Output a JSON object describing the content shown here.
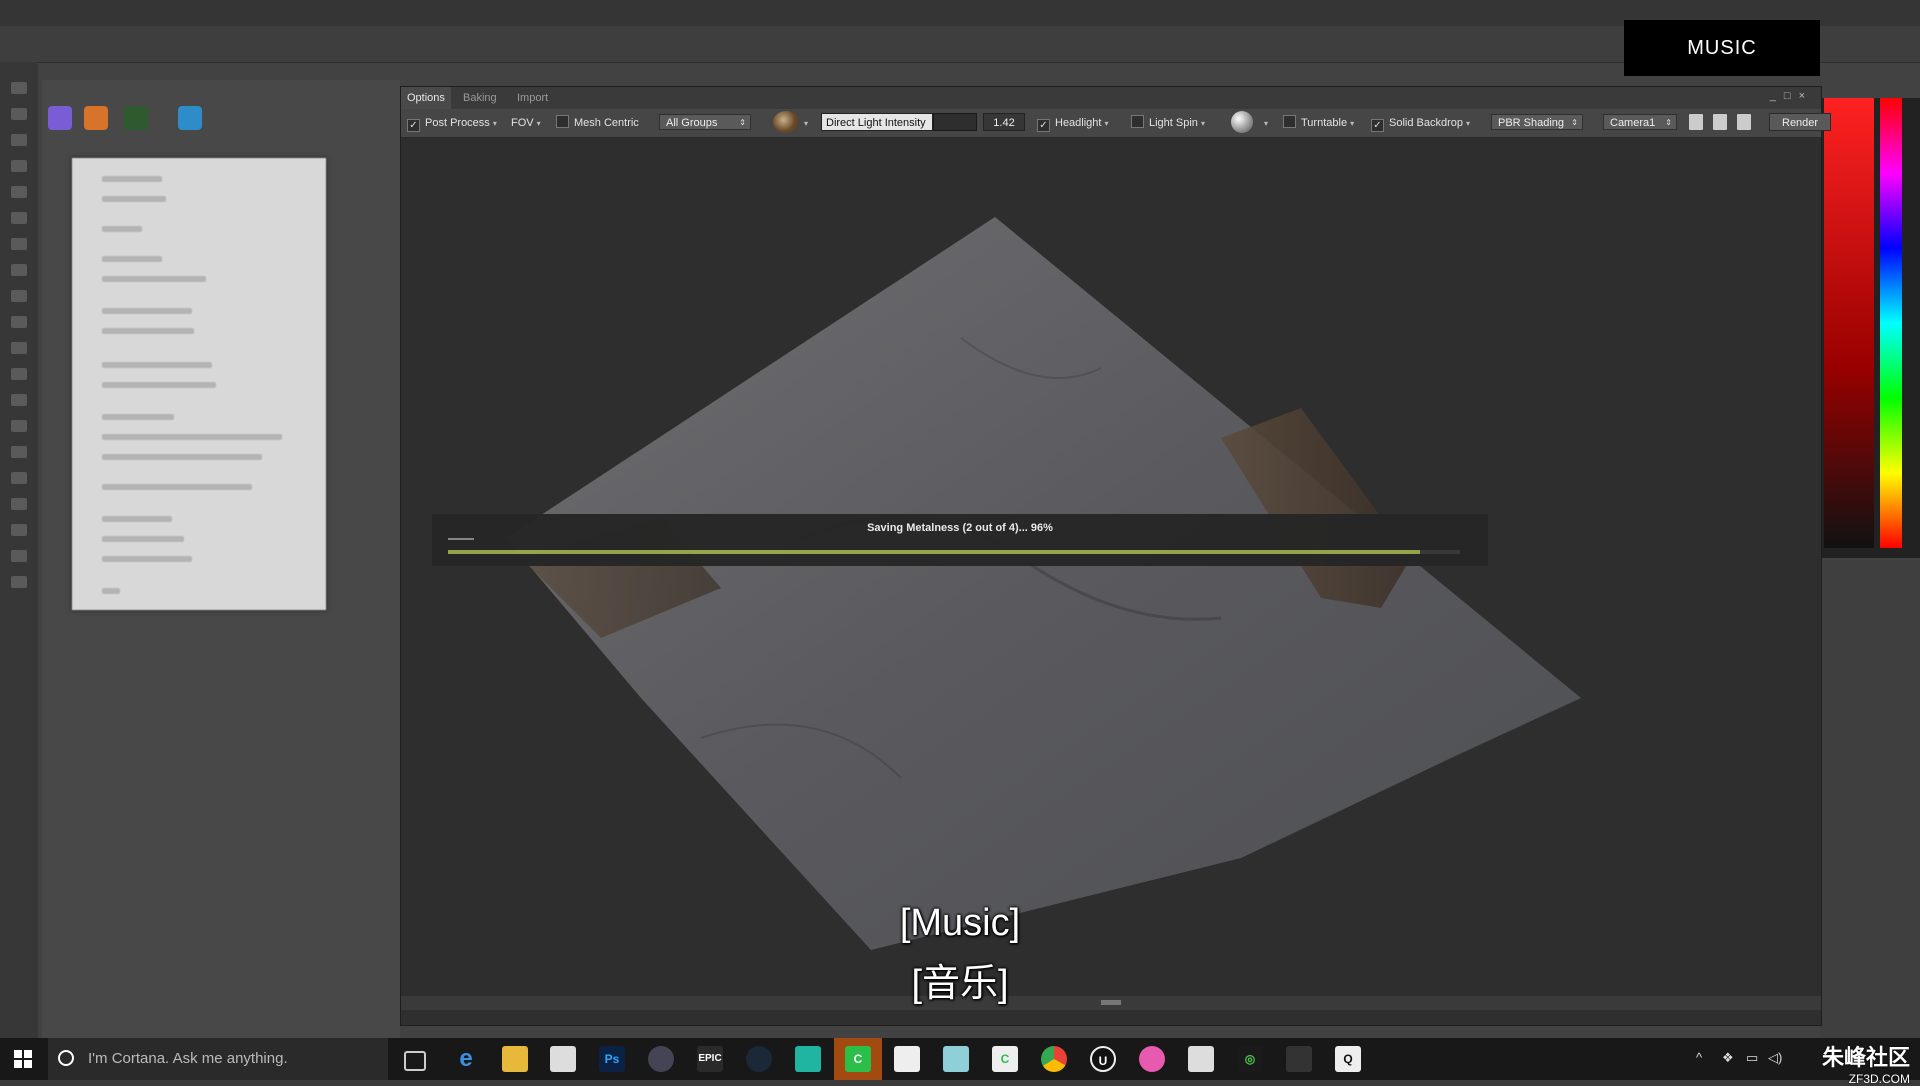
{
  "overlay": {
    "music_tag": "MUSIC"
  },
  "renderer": {
    "tabs": [
      {
        "label": "Options",
        "active": true
      },
      {
        "label": "Baking",
        "active": false
      },
      {
        "label": "Import",
        "active": false
      }
    ],
    "options_bar": {
      "post_process": {
        "label": "Post Process",
        "checked": true
      },
      "fov": {
        "label": "FOV"
      },
      "mesh_centric": {
        "label": "Mesh Centric",
        "checked": false
      },
      "groups_select": "All Groups",
      "light_intensity_label": "Direct Light Intensity",
      "light_intensity_value": "1.42",
      "headlight": {
        "label": "Headlight",
        "checked": true
      },
      "light_spin": {
        "label": "Light Spin",
        "checked": false
      },
      "turntable": {
        "label": "Turntable",
        "checked": false
      },
      "solid_backdrop": {
        "label": "Solid Backdrop",
        "checked": true
      },
      "shading_select": "PBR Shading",
      "camera_select": "Camera1",
      "render_button": "Render"
    },
    "progress": {
      "text": "Saving Metalness (2 out of 4)... 96%",
      "fraction": 0.96,
      "bar_color": "#9aa84a"
    }
  },
  "subtitles": {
    "line1": "[Music]",
    "line2": "[音乐]"
  },
  "taskbar": {
    "cortana_placeholder": "I'm Cortana. Ask me anything.",
    "icons": [
      "task-view-icon",
      "edge-icon",
      "file-explorer-icon",
      "store-icon",
      "photoshop-icon",
      "marmoset-icon",
      "epic-games-icon",
      "steam-icon",
      "app-icon",
      "active-app-icon",
      "photos-icon",
      "app-icon-2",
      "app-icon-3",
      "chrome-icon",
      "unreal-engine-icon",
      "itunes-icon",
      "app-icon-4",
      "app-icon-5",
      "app-icon-6",
      "app-icon-7"
    ],
    "watermark_line1": "朱峰社区",
    "watermark_line2": "ZF3D.COM"
  }
}
